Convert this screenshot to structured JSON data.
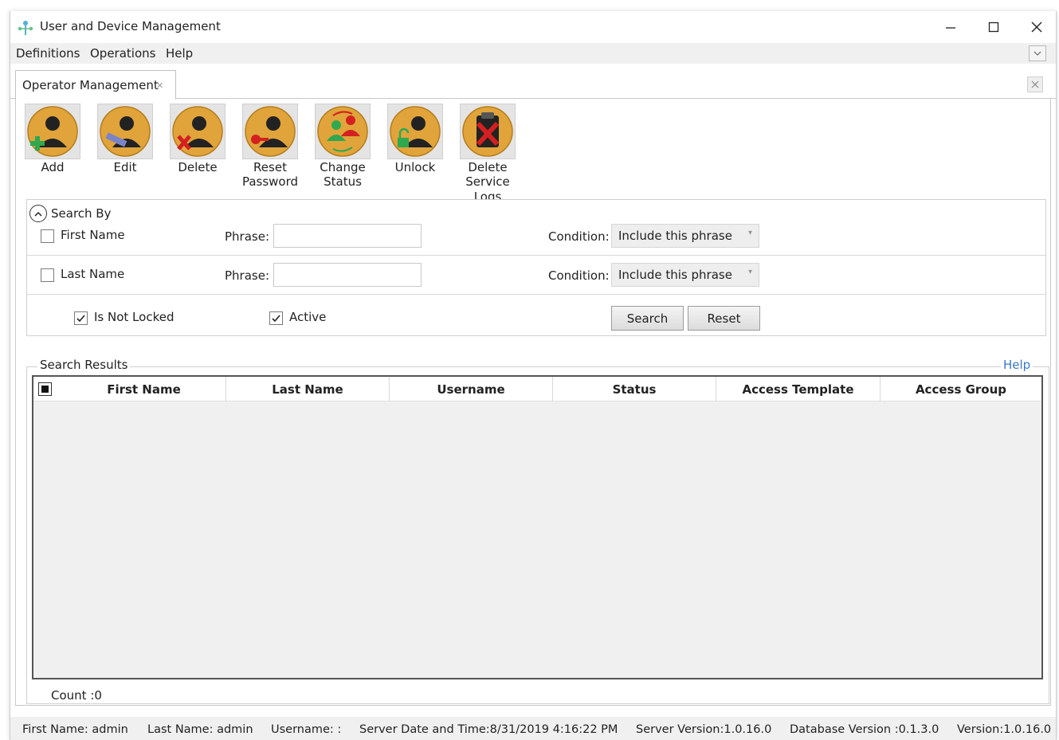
{
  "window": {
    "title": "User and Device Management",
    "controls": {
      "minimize": "—",
      "maximize": "☐",
      "close": "✕"
    }
  },
  "menubar": {
    "items": [
      "Definitions",
      "Operations",
      "Help"
    ],
    "collapse_icon": "chevron-down-icon"
  },
  "tabs": [
    {
      "label": "Operator Management",
      "close_icon": "close-icon"
    }
  ],
  "toolbar": {
    "buttons": [
      {
        "label_1": "Add",
        "label_2": "",
        "icon": "add-operator-icon"
      },
      {
        "label_1": "Edit",
        "label_2": "",
        "icon": "edit-operator-icon"
      },
      {
        "label_1": "Delete",
        "label_2": "",
        "icon": "delete-operator-icon"
      },
      {
        "label_1": "Reset",
        "label_2": "Password",
        "icon": "reset-password-icon"
      },
      {
        "label_1": "Change",
        "label_2": "Status",
        "icon": "change-status-icon"
      },
      {
        "label_1": "Unlock",
        "label_2": "",
        "icon": "unlock-icon"
      },
      {
        "label_1": "Delete",
        "label_2": "Service Logs",
        "icon": "delete-service-logs-icon"
      }
    ],
    "accent_color": "#e0a43a"
  },
  "search": {
    "title": "Search By",
    "first_name": {
      "label": "First Name",
      "checked": false,
      "phrase_label": "Phrase:",
      "phrase_value": "",
      "condition_label": "Condition:",
      "condition_value": "Include this phrase"
    },
    "last_name": {
      "label": "Last Name",
      "checked": false,
      "phrase_label": "Phrase:",
      "phrase_value": "",
      "condition_label": "Condition:",
      "condition_value": "Include this phrase"
    },
    "is_not_locked": {
      "label": "Is Not Locked",
      "checked": true
    },
    "active": {
      "label": "Active",
      "checked": true
    },
    "search_button": "Search",
    "reset_button": "Reset"
  },
  "results": {
    "title": "Search Results",
    "help_link": "Help",
    "columns": [
      "First Name",
      "Last Name",
      "Username",
      "Status",
      "Access Template",
      "Access Group"
    ],
    "rows": [],
    "count_label": "Count :0"
  },
  "statusbar": {
    "first_name": "First Name: admin",
    "last_name": "Last Name: admin",
    "username": "Username: :",
    "server_time": "Server Date and Time:8/31/2019 4:16:22 PM",
    "server_version": "Server Version:1.0.16.0",
    "database_version": "Database Version :0.1.3.0",
    "version": "Version:1.0.16.0"
  }
}
